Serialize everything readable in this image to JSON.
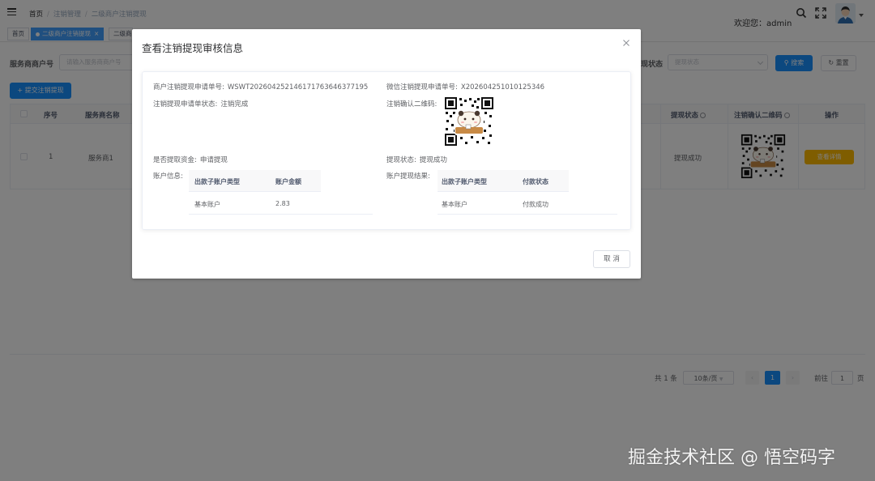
{
  "breadcrumb": [
    "首页",
    "注销管理",
    "二级商户注销提现"
  ],
  "header": {
    "welcome": "欢迎您：admin"
  },
  "tags": [
    {
      "label": "首页"
    },
    {
      "label": "二级商户注销提现",
      "close": "×"
    },
    {
      "label": "二级商"
    }
  ],
  "filters": {
    "merchant_label": "服务商商户号",
    "merchant_placeholder": "请输入服务商商户号",
    "status_label": "现状态",
    "status_placeholder": "提现状态",
    "search_label": "搜索",
    "reset_label": "重置"
  },
  "toolbar": {
    "submit_label": "+ 提交注销提现"
  },
  "table": {
    "headers": {
      "index": "序号",
      "name": "服务商名称",
      "status": "提现状态",
      "qr": "注销确认二维码",
      "action": "操作"
    },
    "rows": [
      {
        "index": "1",
        "name": "服务商1",
        "status": "提现成功",
        "action": "查看详情"
      }
    ]
  },
  "pagination": {
    "total": "共 1 条",
    "page_size": "10条/页",
    "current": "1",
    "goto_label": "前往",
    "goto_value": "1",
    "page_suffix": "页"
  },
  "dialog": {
    "title": "查看注销提现审核信息",
    "apply_no_label": "商户注销提现申请单号:",
    "apply_no": "WSWT2026042521461717636463771​95",
    "wx_no_label": "微信注销提现申请单号:",
    "wx_no": "X202604251010125346",
    "apply_status_label": "注销提现申请单状态:",
    "apply_status": "注销完成",
    "qr_label": "注销确认二维码:",
    "withdraw_funds_label": "是否提取资金:",
    "withdraw_funds": "申请提现",
    "withdraw_status_label": "提现状态:",
    "withdraw_status": "提现成功",
    "account_label": "账户信息:",
    "account_table": {
      "col1": "出款子账户类型",
      "col2": "账户金额",
      "row_type": "基本账户",
      "row_amount": "2.83"
    },
    "result_label": "账户提现结果:",
    "result_table": {
      "col1": "出款子账户类型",
      "col2": "付款状态",
      "row_type": "基本账户",
      "row_status": "付款成功"
    },
    "cancel_label": "取 消"
  },
  "watermark": "掘金技术社区 @ 悟空码字",
  "colors": {
    "primary": "#1890ff",
    "warning": "#ffba00",
    "tag_active": "#409eff"
  }
}
